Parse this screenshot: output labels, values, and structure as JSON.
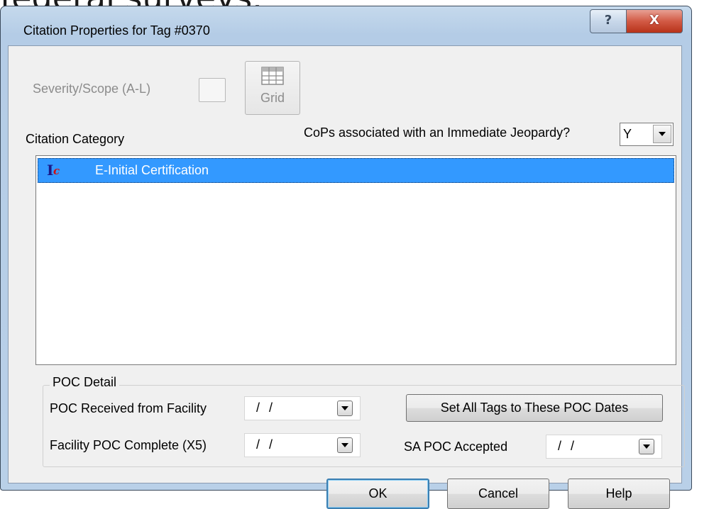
{
  "background": {
    "partial_text": "federal surveys."
  },
  "window": {
    "title": "Citation Properties for Tag #0370",
    "help_glyph": "?",
    "close_glyph": "X"
  },
  "severity": {
    "label": "Severity/Scope (A-L)",
    "value": "",
    "grid_button_label": "Grid",
    "grid_icon": "grid-table-icon",
    "enabled": false
  },
  "citation": {
    "category_label": "Citation Category",
    "ij_question": "CoPs associated with an Immediate Jeopardy?",
    "ij_value": "Y",
    "items": [
      {
        "icon": "ic-icon",
        "icon_text_1": "I",
        "icon_text_2": "c",
        "label": "E-Initial Certification",
        "selected": true
      }
    ]
  },
  "poc": {
    "group_label": "POC Detail",
    "received_label": "POC Received from Facility",
    "received_value": "/ /",
    "complete_label": "Facility POC Complete (X5)",
    "complete_value": "/ /",
    "set_all_button": "Set All Tags to These POC Dates",
    "sa_accepted_label": "SA POC Accepted",
    "sa_accepted_value": "/ /"
  },
  "buttons": {
    "ok": "OK",
    "cancel": "Cancel",
    "help": "Help"
  },
  "colors": {
    "selection": "#3399ff",
    "close_button": "#c7432a",
    "default_button_border": "#3c7fb1"
  }
}
